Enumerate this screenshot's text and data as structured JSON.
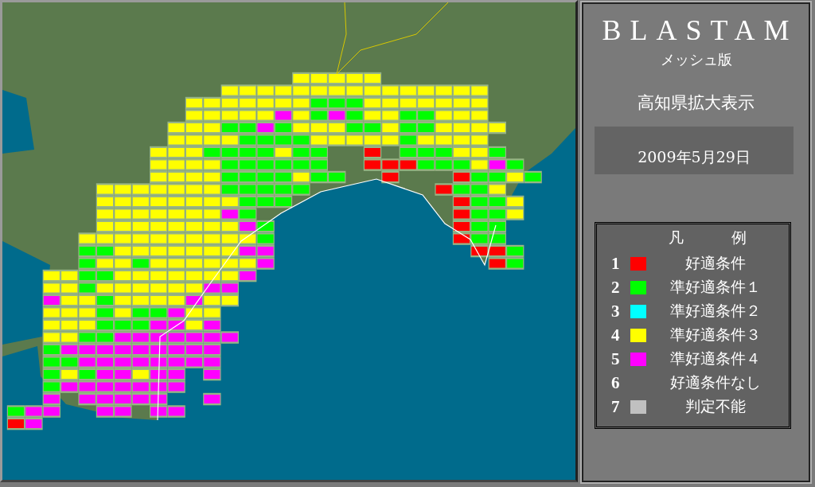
{
  "header": {
    "title": "BLASTAM",
    "subtitle": "メッシュ版",
    "region": "高知県拡大表示",
    "date": "2009年5月29日"
  },
  "legend": {
    "title_left": "凡",
    "title_right": "例",
    "items": [
      {
        "number": "1",
        "label": "好適条件",
        "color": "#ff0000"
      },
      {
        "number": "2",
        "label": "準好適条件１",
        "color": "#00ff00"
      },
      {
        "number": "3",
        "label": "準好適条件２",
        "color": "#00ffff"
      },
      {
        "number": "4",
        "label": "準好適条件３",
        "color": "#ffff00"
      },
      {
        "number": "5",
        "label": "準好適条件４",
        "color": "#ff00ff"
      },
      {
        "number": "6",
        "label": "好適条件なし"
      },
      {
        "number": "7",
        "label": "判定不能",
        "color": "#c0c0c0"
      }
    ]
  }
}
